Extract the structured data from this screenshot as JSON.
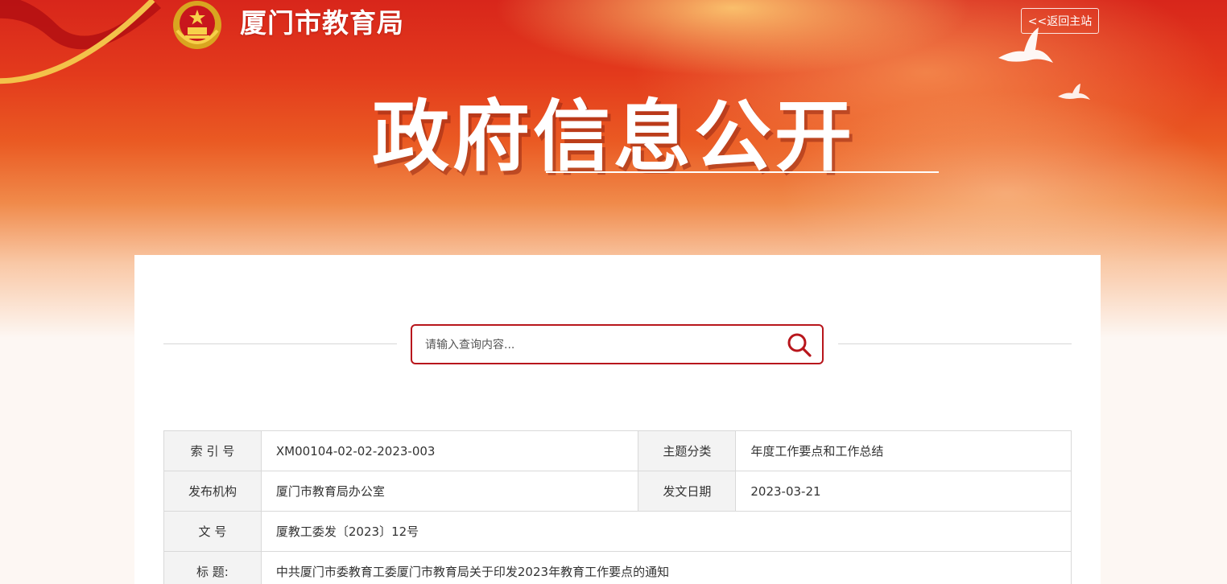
{
  "header": {
    "site_name": "厦门市教育局",
    "back_link": "<<返回主站",
    "hero_title": "政府信息公开"
  },
  "search": {
    "placeholder": "请输入查询内容..."
  },
  "info_table": {
    "index_label": "索 引 号",
    "index_value": "XM00104-02-02-2023-003",
    "topic_label": "主题分类",
    "topic_value": "年度工作要点和工作总结",
    "publisher_label": "发布机构",
    "publisher_value": "厦门市教育局办公室",
    "date_label": "发文日期",
    "date_value": "2023-03-21",
    "docno_label": "文 号",
    "docno_value": "厦教工委发〔2023〕12号",
    "title_label": "标 题:",
    "title_value": "中共厦门市委教育工委厦门市教育局关于印发2023年教育工作要点的通知"
  },
  "colors": {
    "accent_red": "#b8161c",
    "banner_red": "#d8261b"
  },
  "icons": [
    "national-emblem-icon",
    "dove-icon",
    "search-icon"
  ]
}
